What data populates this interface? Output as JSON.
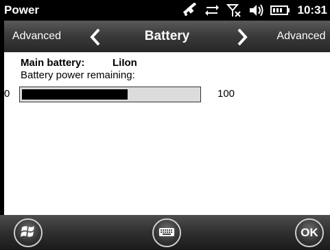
{
  "status_bar": {
    "app_title": "Power",
    "clock": "10:31",
    "icons": [
      "gps-icon",
      "data-transfer-icon",
      "signal-off-icon",
      "volume-icon",
      "battery-icon"
    ]
  },
  "nav": {
    "left_label": "Advanced",
    "title": "Battery",
    "right_label": "Advanced"
  },
  "content": {
    "main_battery_label": "Main battery:",
    "battery_type": "LiIon",
    "remaining_label": "Battery power remaining:",
    "range_min": "0",
    "range_max": "100",
    "remaining_fraction": 0.6
  },
  "softkeys": {
    "ok_label": "OK",
    "left_icon": "windows-start-icon",
    "center_icon": "keyboard-icon"
  }
}
